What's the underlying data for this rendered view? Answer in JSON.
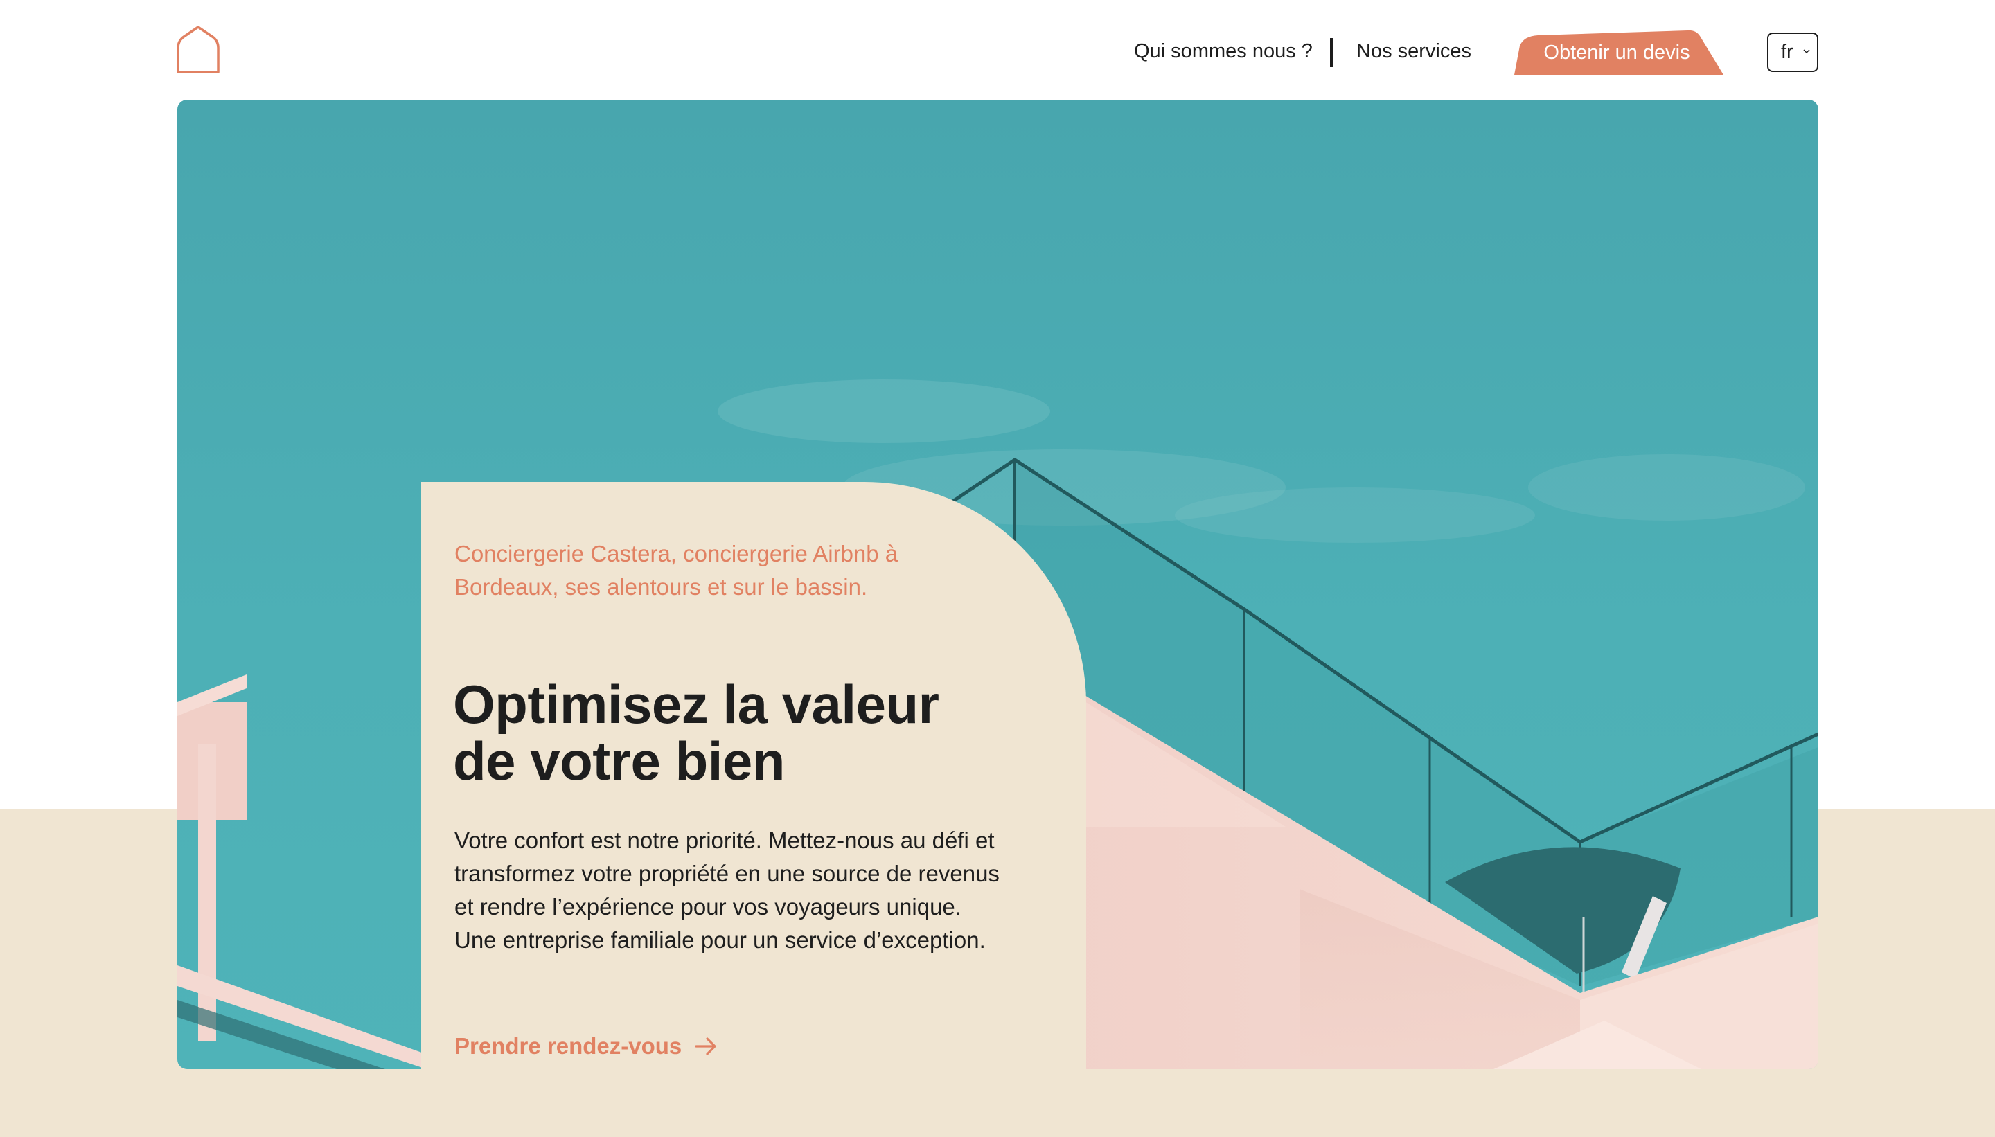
{
  "header": {
    "logo_icon": "house-outline-icon",
    "nav": [
      {
        "label": "Qui sommes nous ?"
      },
      {
        "label": "Nos services"
      }
    ],
    "cta_label": "Obtenir un devis",
    "language": {
      "selected": "fr",
      "icon": "chevron-down-icon"
    }
  },
  "hero": {
    "tagline": "Conciergerie Castera, conciergerie Airbnb à Bordeaux, ses alentours et sur le bassin.",
    "headline": "Optimisez la valeur de votre bien",
    "body": "Votre confort est notre priorité. Mettez-nous au défi et transformez votre propriété en une source de revenus et rendre l’expérience pour vos voyageurs unique. Une entreprise familiale pour un service d’exception.",
    "cta_label": "Prendre rendez-vous",
    "cta_icon": "arrow-right-icon"
  },
  "colors": {
    "accent": "#e18162",
    "beige": "#f0e5d2",
    "sky": "#4aabb2",
    "wall": "#f3d3cc",
    "text": "#1e1e1e"
  }
}
